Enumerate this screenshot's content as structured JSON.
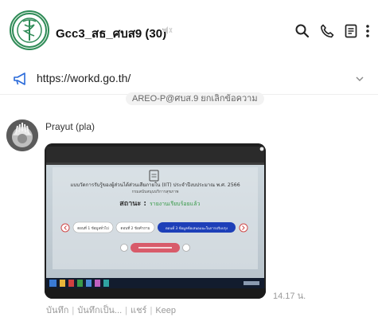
{
  "header": {
    "title": "Gcc3_สธ_ศบส9 (30)",
    "icons": [
      "search-icon",
      "phone-icon",
      "notes-icon",
      "more-icon"
    ]
  },
  "pinned_url": {
    "text": "https://workd.go.th/"
  },
  "system_message": "AREO-P@ศบส.9 ยกเลิกข้อความ",
  "message": {
    "sender": "Prayut (pla)",
    "time": "14.17 น.",
    "photo": {
      "form_title": "แบบวัดการรับรู้ของผู้ส่วนได้ส่วนเสียภายใน (IIT) ประจำปีงบประมาณ พ.ศ. 2566",
      "form_sub": "กรมสนับสนุนบริการสุขภาพ",
      "status_label": "สถานะ :",
      "status_value": "รายงานเรียบร้อยแล้ว",
      "tabs": [
        "ตอนที่ 1 ข้อมูลทั่วไป",
        "ตอนที่ 2 ข้อคำถาม",
        "ตอนที่ 3 ข้อมูลข้อเสนอแนะในการปรับปรุง"
      ]
    }
  },
  "actions": [
    "บันทึก",
    "บันทึกเป็น...",
    "แชร์",
    "Keep"
  ]
}
